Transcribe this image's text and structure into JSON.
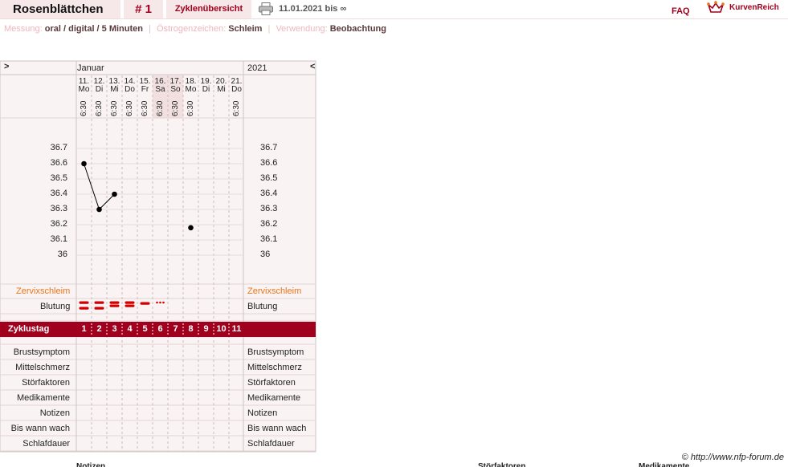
{
  "header": {
    "title": "Rosenblättchen",
    "cycle_number": "# 1",
    "overview_link": "Zyklenübersicht",
    "print_icon": "printer-icon",
    "date_range": "11.01.2021 bis ∞",
    "faq": "FAQ",
    "logo_text": "KurvenReich",
    "logo_icon": "crown-icon"
  },
  "settings": {
    "measurement_label": "Messung:",
    "measurement_value": "oral / digital / 5 Minuten",
    "estrogen_label": "Östrogenzeichen:",
    "estrogen_value": "Schleim",
    "usage_label": "Verwendung:",
    "usage_value": "Beobachtung"
  },
  "calendar": {
    "nav_next": ">",
    "nav_prev": "<",
    "month": "Januar",
    "year": "2021",
    "days": [
      {
        "date": "11.",
        "weekday": "Mo",
        "time": "6:30",
        "weekend": false
      },
      {
        "date": "12.",
        "weekday": "Di",
        "time": "6:30",
        "weekend": false
      },
      {
        "date": "13.",
        "weekday": "Mi",
        "time": "6:30",
        "weekend": false
      },
      {
        "date": "14.",
        "weekday": "Do",
        "time": "6:30",
        "weekend": false
      },
      {
        "date": "15.",
        "weekday": "Fr",
        "time": "6:30",
        "weekend": false
      },
      {
        "date": "16.",
        "weekday": "Sa",
        "time": "6:30",
        "weekend": true
      },
      {
        "date": "17.",
        "weekday": "So",
        "time": "6:30",
        "weekend": true
      },
      {
        "date": "18.",
        "weekday": "Mo",
        "time": "6:30",
        "weekend": false
      },
      {
        "date": "19.",
        "weekday": "Di",
        "time": "",
        "weekend": false
      },
      {
        "date": "20.",
        "weekday": "Mi",
        "time": "",
        "weekend": false
      },
      {
        "date": "21.",
        "weekday": "Do",
        "time": "6:30",
        "weekend": false
      }
    ]
  },
  "chart_data": {
    "type": "line",
    "yticks": [
      36.7,
      36.6,
      36.5,
      36.4,
      36.3,
      36.2,
      36.1,
      36
    ],
    "ytick_labels": [
      "36.7",
      "36.6",
      "36.5",
      "36.4",
      "36.3",
      "36.2",
      "36.1",
      "36"
    ],
    "ylim": [
      35.9,
      36.8
    ],
    "x": [
      11,
      12,
      13,
      18
    ],
    "values": [
      36.6,
      36.3,
      36.4,
      36.18
    ],
    "connected_segments": [
      [
        0,
        1
      ],
      [
        1,
        2
      ]
    ],
    "grid": true,
    "line_color": "#000000"
  },
  "rows": {
    "mucus_label": "Zervixschleim",
    "bleeding_label": "Blutung",
    "bleeding": [
      "heavy",
      "heavy",
      "medium",
      "medium",
      "light",
      "spotting",
      "",
      "",
      "",
      "",
      ""
    ],
    "cycle_day_label": "Zyklustag",
    "cycle_days": [
      "1",
      "2",
      "3",
      "4",
      "5",
      "6",
      "7",
      "8",
      "9",
      "10",
      "11"
    ],
    "extra_labels": [
      "Brustsymptom",
      "Mittelschmerz",
      "Störfaktoren",
      "Medikamente",
      "Notizen",
      "Bis wann wach",
      "Schlafdauer"
    ]
  },
  "footer": {
    "copyright": "© http://www.nfp-forum.de",
    "bottom_headers": [
      "Notizen",
      "Störfaktoren",
      "Medikamente"
    ]
  },
  "colors": {
    "accent": "#a0001e",
    "panel_bg": "#faf3f3",
    "weekend_bg": "#f2e0e0",
    "mucus_label": "#e8761c",
    "bleeding": "#d40000",
    "grid": "#cfc4c4"
  }
}
